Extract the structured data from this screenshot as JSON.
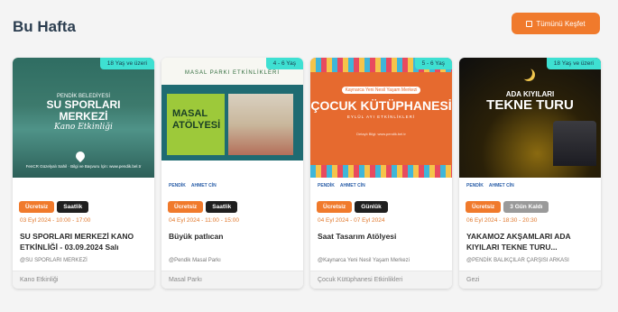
{
  "section_title": "Bu Hafta",
  "discover_label": "Tümünü Keşfet",
  "cards": [
    {
      "age": "18 Yaş ve üzeri",
      "art": {
        "t1": "PENDİK BELEDİYESİ",
        "t2": "SU SPORLARI MERKEZİ",
        "t3": "Kano Etkinliği",
        "foot": "FenCR Güzelyalı Sahil · Bilgi ve Başvuru İçin: www.pendik.bel.tr"
      },
      "badge1": "Ücretsiz",
      "badge2": "Saatlik",
      "date": "03 Eyl 2024 - 10:00 - 17:00",
      "name": "SU SPORLARI MERKEZİ KANO ETKİNLİĞİ - 03.09.2024 Salı",
      "org": "@SU SPORLARI MERKEZİ",
      "category": "Kano Etkinliği"
    },
    {
      "age": "4 - 6 Yaş",
      "art": {
        "top": "MASAL PARKI ETKİNLİKLERİ",
        "panel": "MASAL ATÖLYESİ"
      },
      "logo1": "PENDİK",
      "logo2": "AHMET CİN",
      "badge1": "Ücretsiz",
      "badge2": "Saatlik",
      "date": "04 Eyl 2024 - 11:00 - 15:00",
      "name": "Büyük patlıcan",
      "org": "@Pendik Masal Parkı",
      "category": "Masal Parkı"
    },
    {
      "age": "5 - 6 Yaş",
      "art": {
        "c1": "Kaynarca Yeni Nesil Yaşam Merkezi",
        "c2": "ÇOCUK KÜTÜPHANESİ",
        "c3": "EYLÜL AYI ETKİNLİKLERİ",
        "c4": "Detaylı Bilgi: www.pendik.bel.tr"
      },
      "logo1": "PENDİK",
      "logo2": "AHMET CİN",
      "badge1": "Ücretsiz",
      "badge2": "Günlük",
      "date": "04 Eyl 2024 - 07 Eyl 2024",
      "name": "Saat Tasarım Atölyesi",
      "org": "@Kaynarca Yeni Nesil Yaşam Merkezi",
      "category": "Çocuk Kütüphanesi Etkinlikleri"
    },
    {
      "age": "18 Yaş ve üzeri",
      "art": {
        "d1": "ADA KIYILARI",
        "d2": "TEKNE TURU"
      },
      "logo1": "PENDİK",
      "logo2": "AHMET CİN",
      "badge1": "Ücretsiz",
      "badge2": "3 Gün Kaldı",
      "date": "06 Eyl 2024 - 18:30 - 20:30",
      "name": "YAKAMOZ AKŞAMLARI ADA KIYILARI TEKNE TURU...",
      "org": "@PENDİK BALIKÇILAR ÇARŞISI ARKASI",
      "category": "Gezi"
    }
  ]
}
